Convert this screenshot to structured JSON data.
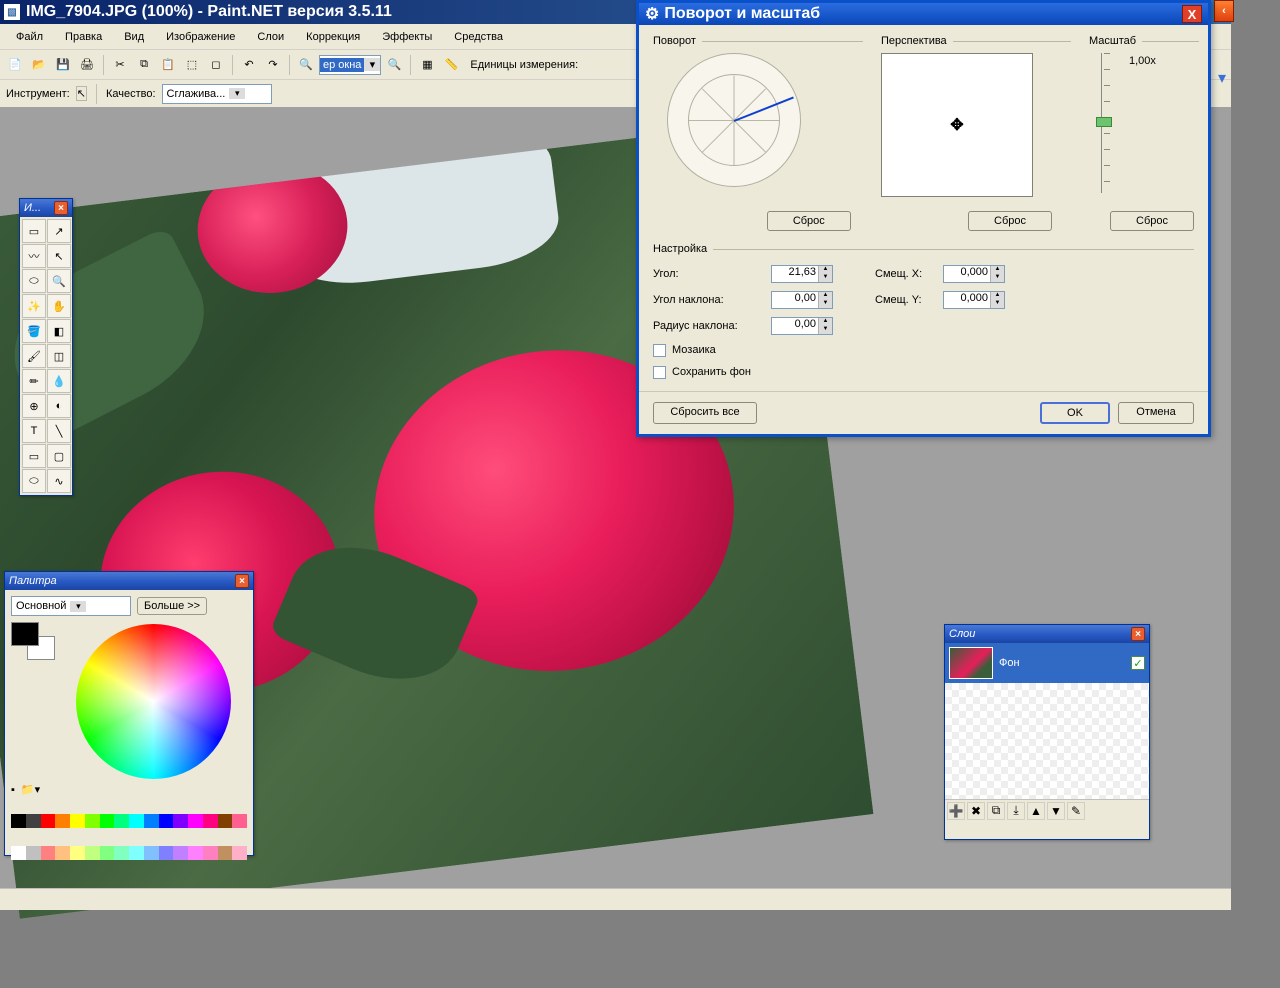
{
  "titlebar": {
    "text": "IMG_7904.JPG (100%) - Paint.NET версия 3.5.11"
  },
  "menubar": [
    "Файл",
    "Правка",
    "Вид",
    "Изображение",
    "Слои",
    "Коррекция",
    "Эффекты",
    "Средства"
  ],
  "toolbar": {
    "zoom_combo": "ер окна",
    "units_label": "Единицы измерения:"
  },
  "toolbar2": {
    "tool_label": "Инструмент:",
    "quality_label": "Качество:",
    "quality_value": "Сглажива..."
  },
  "tools_panel": {
    "title": "И..."
  },
  "colors_panel": {
    "title": "Палитра",
    "mode": "Основной",
    "more": "Больше >>",
    "strip": [
      "#000",
      "#404040",
      "#ff0000",
      "#ff7f00",
      "#ffff00",
      "#80ff00",
      "#00ff00",
      "#00ff80",
      "#00ffff",
      "#0080ff",
      "#0000ff",
      "#8000ff",
      "#ff00ff",
      "#ff0080",
      "#804000",
      "#ff6090"
    ]
  },
  "layers_panel": {
    "title": "Слои",
    "layer0": "Фон"
  },
  "dialog": {
    "title": "Поворот и масштаб",
    "sec_rotate": "Поворот",
    "sec_persp": "Перспектива",
    "sec_scale": "Масштаб",
    "scale_value": "1,00x",
    "reset": "Сброс",
    "settings_hdr": "Настройка",
    "angle_label": "Угол:",
    "angle_value": "21,63",
    "tilt_label": "Угол наклона:",
    "tilt_value": "0,00",
    "radius_label": "Радиус наклона:",
    "radius_value": "0,00",
    "offx_label": "Смещ. X:",
    "offx_value": "0,000",
    "offy_label": "Смещ. Y:",
    "offy_value": "0,000",
    "mosaic": "Мозаика",
    "keep_bg": "Сохранить фон",
    "reset_all": "Сбросить все",
    "ok": "OK",
    "cancel": "Отмена"
  }
}
